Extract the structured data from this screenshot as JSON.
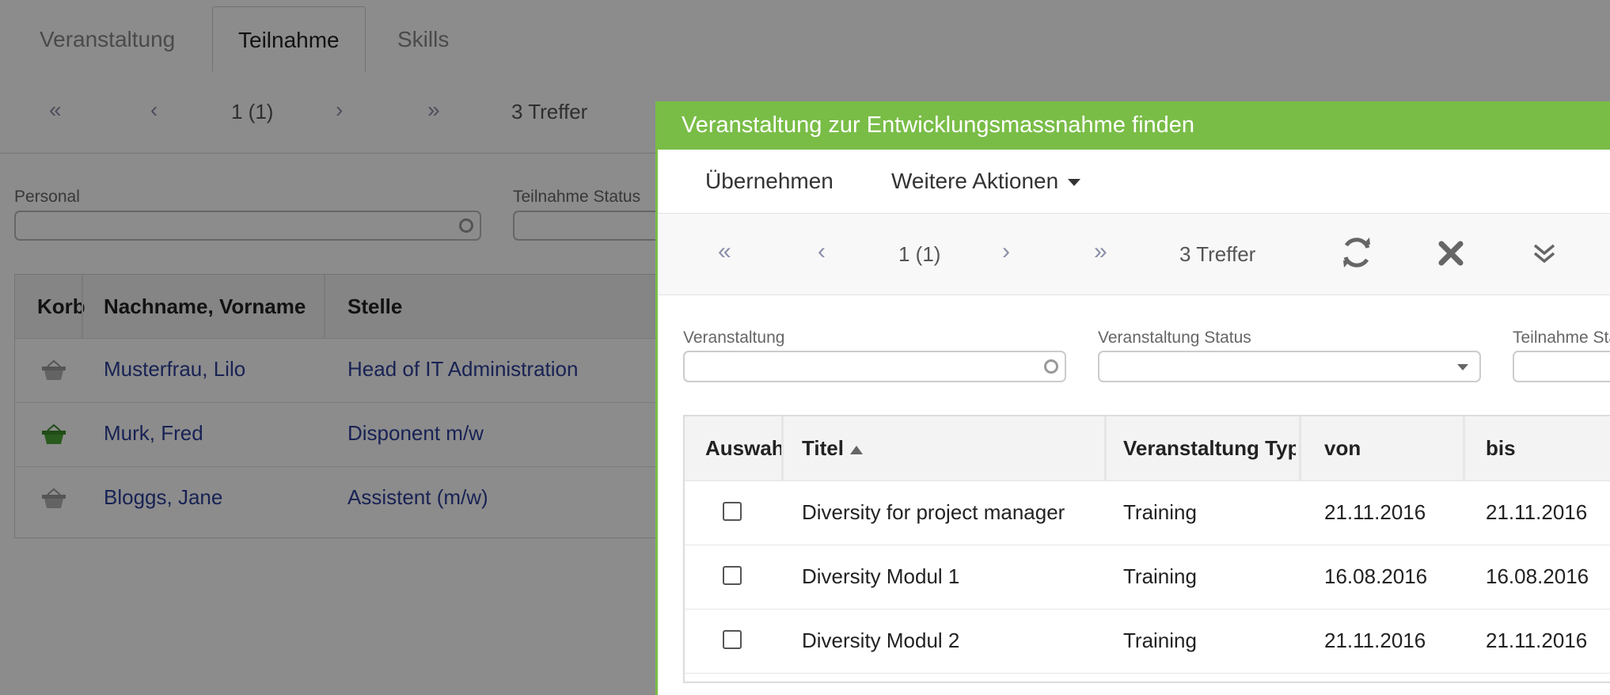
{
  "tabs": [
    {
      "label": "Veranstaltung"
    },
    {
      "label": "Teilnahme"
    },
    {
      "label": "Skills"
    }
  ],
  "pager": {
    "page": "1 (1)",
    "hits": "3 Treffer"
  },
  "filters": {
    "personal_label": "Personal",
    "status_label": "Teilnahme Status"
  },
  "grid": {
    "columns": [
      "Korb",
      "Nachname, Vorname",
      "Stelle"
    ],
    "rows": [
      {
        "name": "Musterfrau, Lilo",
        "position": "Head of IT Administration",
        "basket": "inactive"
      },
      {
        "name": "Murk, Fred",
        "position": "Disponent m/w",
        "basket": "active"
      },
      {
        "name": "Bloggs, Jane",
        "position": "Assistent (m/w)",
        "basket": "inactive"
      }
    ]
  },
  "dialog": {
    "title": "Veranstaltung zur Entwicklungsmassnahme finden",
    "toolbar": {
      "apply_label": "Übernehmen",
      "more_label": "Weitere Aktionen"
    },
    "pager": {
      "page": "1 (1)",
      "hits": "3 Treffer"
    },
    "filters": {
      "event_label": "Veranstaltung",
      "event_status_label": "Veranstaltung Status",
      "participation_status_label": "Teilnahme Status"
    },
    "grid": {
      "columns": [
        "Auswahl",
        "Titel",
        "Veranstaltung Typ",
        "von",
        "bis"
      ],
      "rows": [
        {
          "title": "Diversity for project manager",
          "type": "Training",
          "from": "21.11.2016",
          "to": "21.11.2016",
          "selected": false
        },
        {
          "title": "Diversity Modul 1",
          "type": "Training",
          "from": "16.08.2016",
          "to": "16.08.2016",
          "selected": false
        },
        {
          "title": "Diversity Modul 2",
          "type": "Training",
          "from": "21.11.2016",
          "to": "21.11.2016",
          "selected": false
        }
      ]
    }
  },
  "colors": {
    "accent_green": "#79bd47",
    "link_blue": "#2c3e9a",
    "overlay": "rgba(0,0,0,0.45)"
  }
}
